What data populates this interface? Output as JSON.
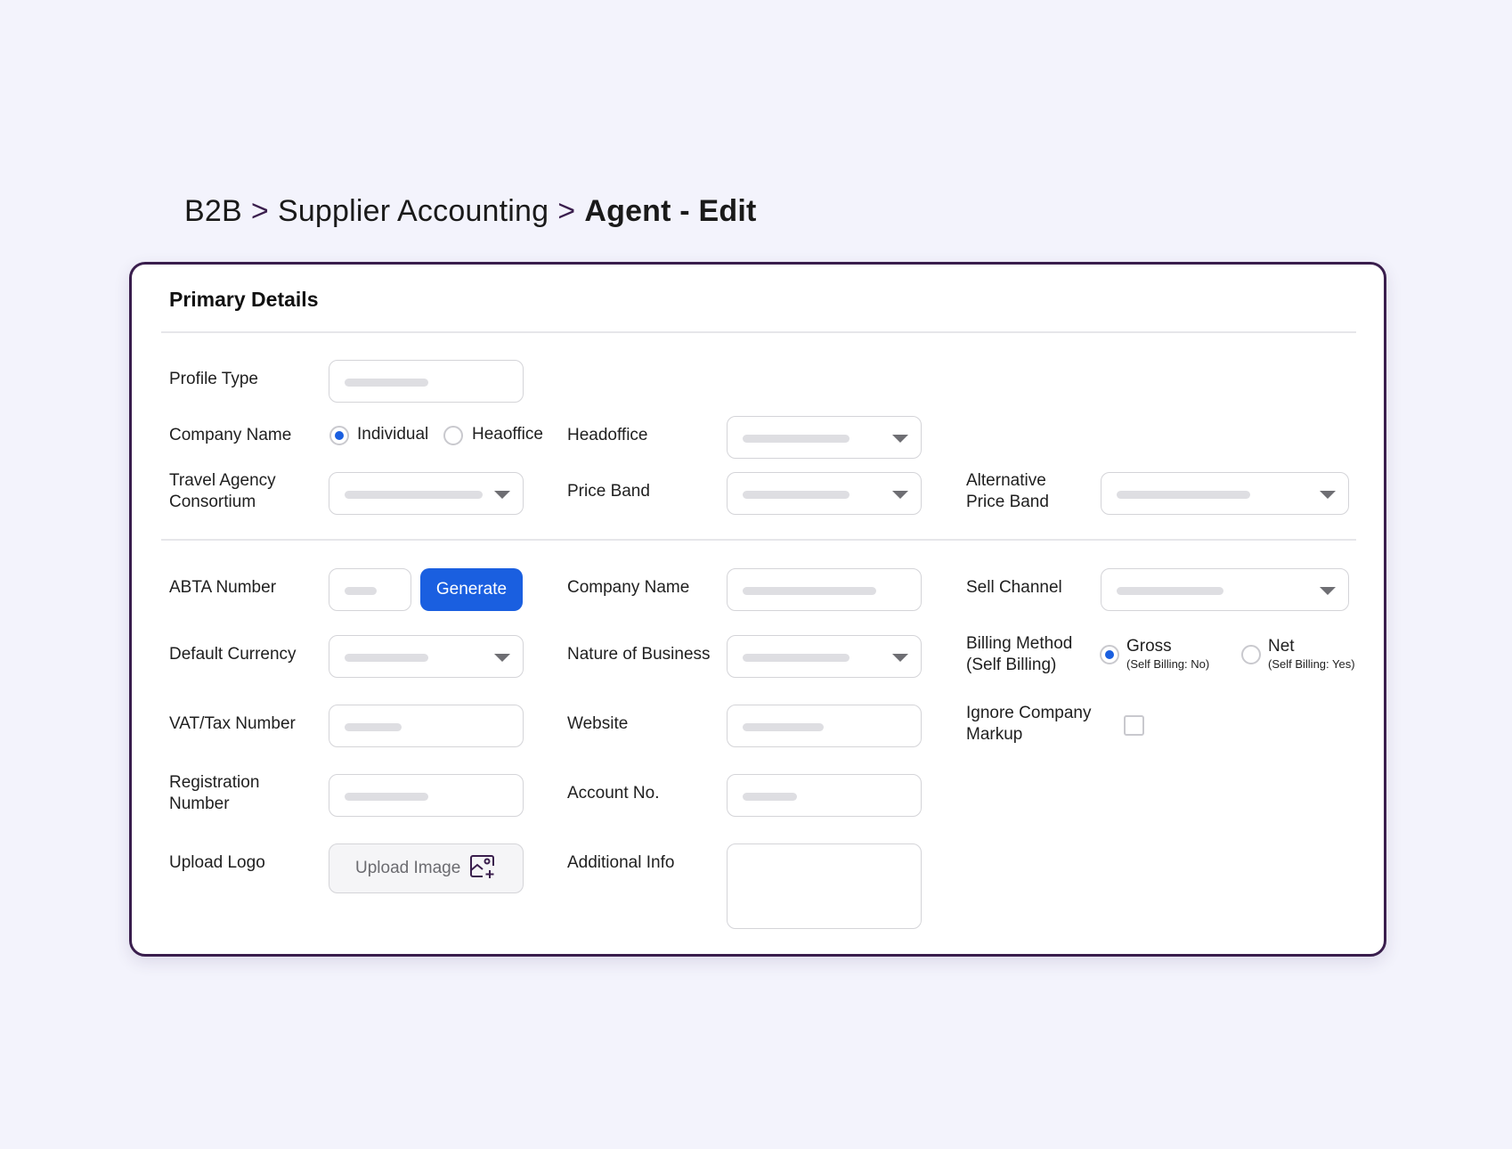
{
  "breadcrumb": {
    "items": [
      "B2B",
      "Supplier Accounting"
    ],
    "separator": ">",
    "current": "Agent - Edit"
  },
  "card": {
    "title": "Primary Details"
  },
  "labels": {
    "profile_type": "Profile Type",
    "company_name": "Company Name",
    "headoffice": "Headoffice",
    "travel_agency_consortium": [
      "Travel Agency",
      "Consortium"
    ],
    "price_band": "Price Band",
    "alternative_price_band": [
      "Alternative",
      "Price Band"
    ],
    "abta_number": "ABTA Number",
    "company_name_2": "Company Name",
    "sell_channel": "Sell Channel",
    "default_currency": "Default Currency",
    "nature_of_business": "Nature of Business",
    "billing_method": [
      "Billing Method",
      "(Self Billing)"
    ],
    "vat_tax_number": "VAT/Tax Number",
    "website": "Website",
    "ignore_company_markup": [
      "Ignore Company",
      "Markup"
    ],
    "registration_number": [
      "Registration",
      "Number"
    ],
    "account_no": "Account No.",
    "upload_logo": "Upload Logo",
    "additional_info": "Additional Info"
  },
  "company_type_radios": {
    "options": [
      "Individual",
      "Heaoffice"
    ],
    "selected": "Individual"
  },
  "billing_radios": {
    "options": [
      {
        "label": "Gross",
        "sub": "(Self Billing: No)"
      },
      {
        "label": "Net",
        "sub": "(Self Billing: Yes)"
      }
    ],
    "selected": "Gross"
  },
  "buttons": {
    "generate": "Generate",
    "upload_image": "Upload Image"
  },
  "ignore_company_markup_checked": false,
  "icons": {
    "dropdown": "chevron-down-icon",
    "upload": "image-add-icon"
  },
  "colors": {
    "accent": "#1a5fe0",
    "card_border": "#3a1e4d",
    "background": "#f3f3fc"
  }
}
